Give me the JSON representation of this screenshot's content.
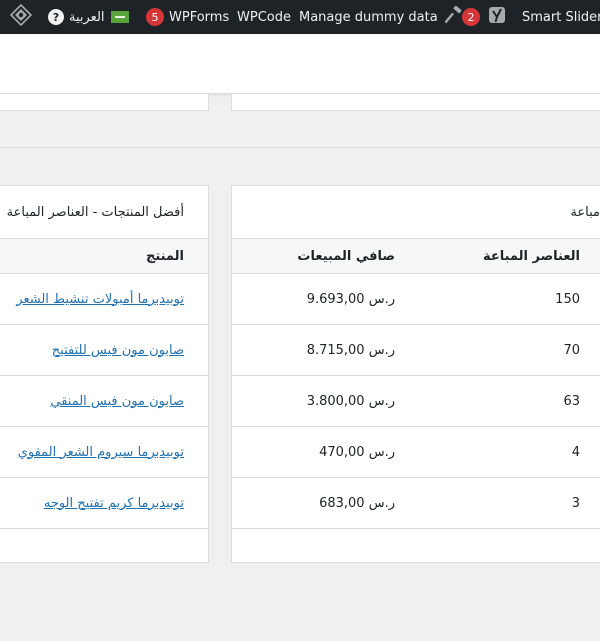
{
  "admin_bar": {
    "wp_logo": "wordpress-icon",
    "language": "العربية",
    "wpforms_count": "5",
    "wpforms_label": "WPForms",
    "wpcode_label": "WPCode",
    "dummy_data_label": "Manage dummy data",
    "yoast_count": "2",
    "smart_slider_label": "Smart Slider"
  },
  "left_card": {
    "title": "أفضل المنتجات - العناصر المباعة",
    "column_product": "المنتج",
    "products": [
      "توبيدبرما أمبولات تنشيط الشعر",
      "صابون مون فيس للتفتيح",
      "صابون مون فيس المنقي",
      "توبيدبرما سيروم الشعر المقوي",
      "توبيدبرما كريم تفتيح الوجه"
    ]
  },
  "right_card": {
    "title": "مباعة",
    "column_net_sales": "صافي المبيعات",
    "column_items_sold": "العناصر المباعة",
    "rows": [
      {
        "net_sales": "9.693,00 ر.س",
        "items_sold": "150"
      },
      {
        "net_sales": "8.715,00 ر.س",
        "items_sold": "70"
      },
      {
        "net_sales": "3.800,00 ر.س",
        "items_sold": "63"
      },
      {
        "net_sales": "470,00 ر.س",
        "items_sold": "4"
      },
      {
        "net_sales": "683,00 ر.س",
        "items_sold": "3"
      }
    ]
  }
}
